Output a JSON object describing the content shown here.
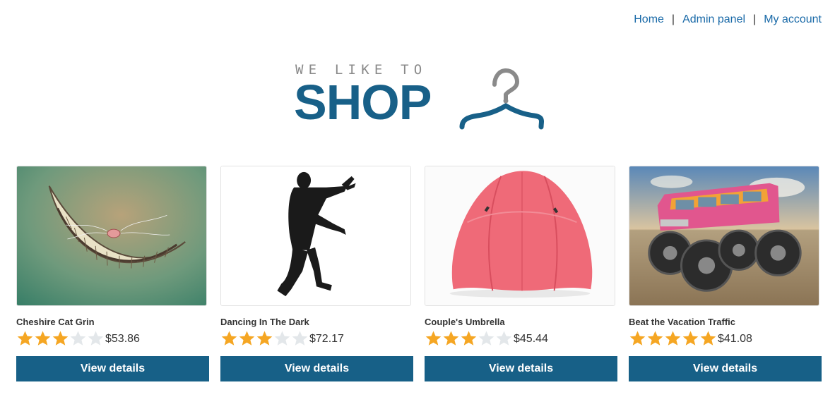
{
  "nav": {
    "home": "Home",
    "admin": "Admin panel",
    "account": "My account",
    "separator": "|"
  },
  "logo": {
    "tagline": "WE LIKE TO",
    "brand": "SHOP",
    "icon": "hanger-icon"
  },
  "colors": {
    "link": "#1a6aa8",
    "brand": "#186088",
    "button": "#176087",
    "star_filled": "#f5a623",
    "star_empty": "#e3e7ea"
  },
  "products": [
    {
      "name": "Cheshire Cat Grin",
      "rating": 3,
      "max_rating": 5,
      "price": "$53.86",
      "button": "View details",
      "image": "cheshire-cat-grin-image"
    },
    {
      "name": "Dancing In The Dark",
      "rating": 3,
      "max_rating": 5,
      "price": "$72.17",
      "button": "View details",
      "image": "dancing-silhouette-image"
    },
    {
      "name": "Couple's Umbrella",
      "rating": 3,
      "max_rating": 5,
      "price": "$45.44",
      "button": "View details",
      "image": "red-umbrella-image"
    },
    {
      "name": "Beat the Vacation Traffic",
      "rating": 5,
      "max_rating": 5,
      "price": "$41.08",
      "button": "View details",
      "image": "monster-van-image"
    }
  ]
}
